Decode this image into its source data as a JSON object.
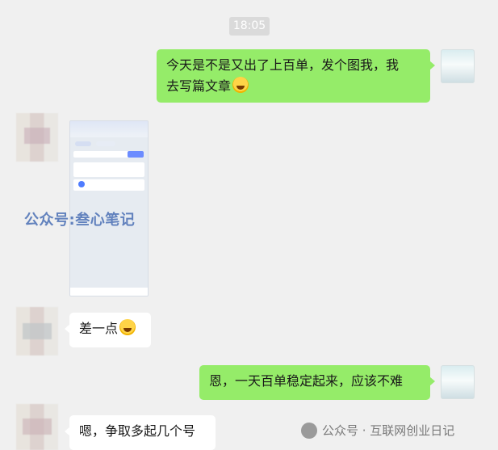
{
  "chat": {
    "timestamp": "18:05",
    "messages": [
      {
        "sender": "me",
        "text": "今天是不是又出了上百单，发个图我，我去写篇文章",
        "emoji": "laughing-emoji"
      },
      {
        "sender": "them",
        "type": "image",
        "caption": "公众号:叁心笔记"
      },
      {
        "sender": "them",
        "text": "差一点",
        "emoji": "laughing-emoji"
      },
      {
        "sender": "me",
        "text": "恩，一天百单稳定起来，应该不难"
      },
      {
        "sender": "them",
        "text": "嗯，争取多起几个号"
      }
    ]
  },
  "message1": {
    "line1": "今天是不是又出了上百单，发个图我，我",
    "line2": "去写篇文章"
  },
  "message3": {
    "text": "差一点"
  },
  "message4": {
    "text": "恩，一天百单稳定起来，应该不难"
  },
  "message5": {
    "text": "嗯，争取多起几个号"
  },
  "image_watermark": "公众号:叁心笔记",
  "footer": {
    "source": "公众号 · 互联网创业日记"
  },
  "colors": {
    "me_bubble": "#95ec69",
    "them_bubble": "#ffffff",
    "background": "#f0f0f0"
  }
}
